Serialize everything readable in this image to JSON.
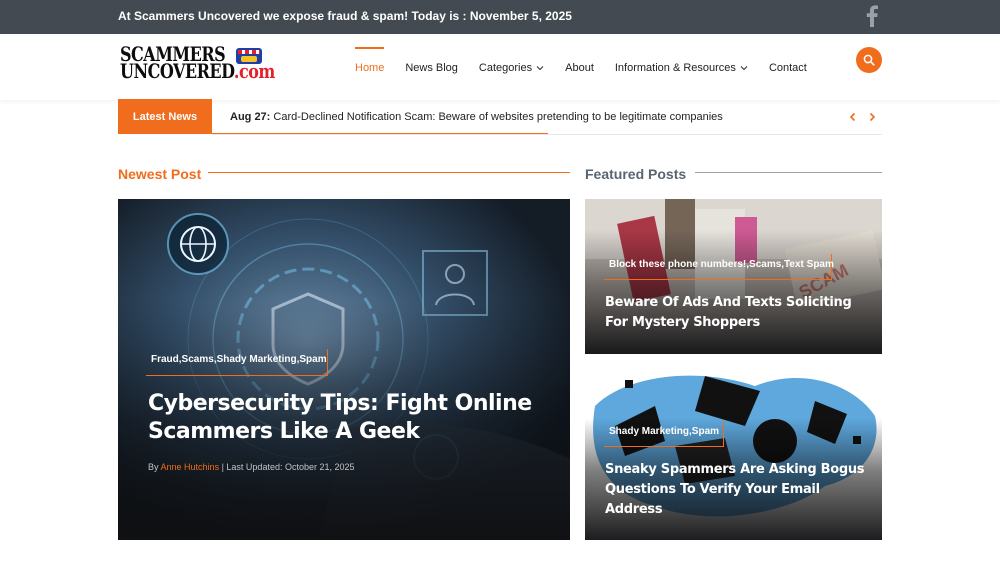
{
  "topbar": {
    "text": "At Scammers Uncovered we expose fraud & spam! Today is : November 5, 2025",
    "social_icon": "facebook-icon"
  },
  "logo": {
    "line1": "SCAMMERS",
    "line2": "UNCOVERED",
    "suffix": ".com"
  },
  "nav": {
    "items": [
      {
        "label": "Home",
        "active": true
      },
      {
        "label": "News Blog"
      },
      {
        "label": "Categories",
        "dropdown": true
      },
      {
        "label": "About"
      },
      {
        "label": "Information & Resources",
        "dropdown": true
      },
      {
        "label": "Contact"
      }
    ],
    "search_icon": "search-icon"
  },
  "ticker": {
    "label": "Latest News",
    "date": "Aug 27:",
    "headline": "Card-Declined Notification Scam: Beware of websites pretending to be legitimate companies"
  },
  "sections": {
    "newest": "Newest Post",
    "featured": "Featured Posts"
  },
  "main_post": {
    "categories": "Fraud,Scams,Shady Marketing,Spam",
    "title": "Cybersecurity Tips: Fight Online Scammers Like A Geek",
    "by": "By",
    "author": "Anne Hutchins",
    "updated": " | Last Updated: October 21, 2025"
  },
  "featured": [
    {
      "categories": "Block these phone numbers!,Scams,Text Spam",
      "title": "Beware Of Ads And Texts Soliciting For Mystery Shoppers"
    },
    {
      "categories": "Shady Marketing,Spam",
      "title": "Sneaky Spammers Are Asking Bogus Questions To Verify Your Email Address"
    }
  ],
  "colors": {
    "accent": "#f06d1d",
    "topbar": "#434a51",
    "featured_heading": "#5a6570"
  }
}
